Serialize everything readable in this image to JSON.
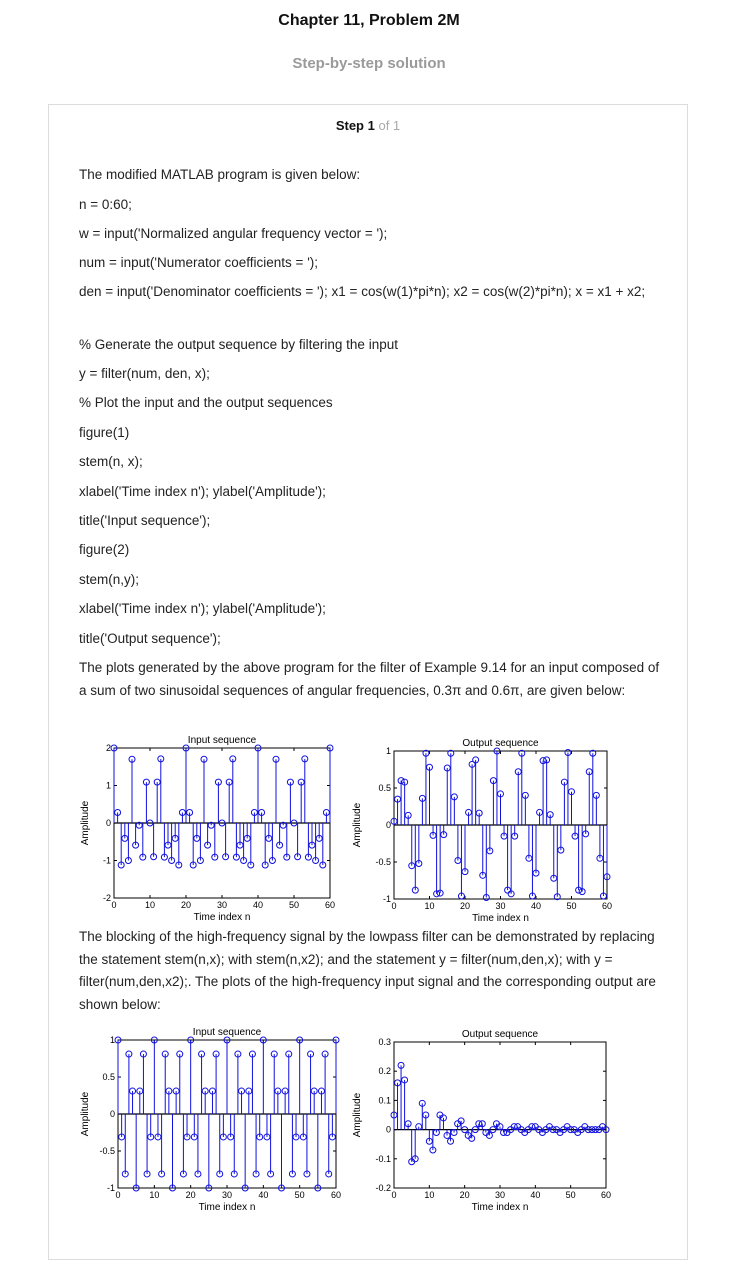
{
  "header": {
    "chapter_title": "Chapter 11, Problem 2M",
    "subtitle": "Step-by-step solution"
  },
  "step": {
    "label": "Step 1",
    "of": "of 1"
  },
  "body": {
    "intro": "The modified MATLAB program is given below:",
    "code": [
      "n = 0:60;",
      "w = input('Normalized angular frequency vector = ');",
      "num = input('Numerator coefficients = ');",
      "den = input('Denominator coefficients = '); x1 = cos(w(1)*pi*n); x2 = cos(w(2)*pi*n); x = x1 + x2;",
      "% Generate the output sequence by filtering the input",
      "y = filter(num, den, x);",
      "% Plot the input and the output sequences",
      "figure(1)",
      "stem(n, x);",
      "xlabel('Time index n'); ylabel('Amplitude');",
      "title('Input sequence');",
      "figure(2)",
      "stem(n,y);",
      "xlabel('Time index n'); ylabel('Amplitude');",
      "title('Output sequence');"
    ],
    "para1": "The plots generated by the above program for the filter of Example 9.14 for an input composed of a sum of two sinusoidal sequences of angular frequencies, 0.3π and 0.6π, are given below:",
    "para2": "The blocking of the high-frequency signal by the lowpass filter can be demonstrated by replacing the statement stem(n,x); with stem(n,x2); and the statement y = filter(num,den,x); with y = filter(num,den,x2);. The plots of the high-frequency input signal and the corresponding output are shown below:"
  },
  "chart_data": [
    {
      "type": "stem",
      "title": "Input sequence",
      "xlabel": "Time index n",
      "ylabel": "Amplitude",
      "xlim": [
        0,
        60
      ],
      "ylim": [
        -2,
        2
      ],
      "xticks": [
        0,
        10,
        20,
        30,
        40,
        50,
        60
      ],
      "yticks": [
        -2,
        -1,
        0,
        1,
        2
      ],
      "x": [
        0,
        1,
        2,
        3,
        4,
        5,
        6,
        7,
        8,
        9,
        10,
        11,
        12,
        13,
        14,
        15,
        16,
        17,
        18,
        19,
        20,
        21,
        22,
        23,
        24,
        25,
        26,
        27,
        28,
        29,
        30,
        31,
        32,
        33,
        34,
        35,
        36,
        37,
        38,
        39,
        40,
        41,
        42,
        43,
        44,
        45,
        46,
        47,
        48,
        49,
        50,
        51,
        52,
        53,
        54,
        55,
        56,
        57,
        58,
        59,
        60
      ],
      "y": [
        2,
        0.28,
        -1.12,
        -0.41,
        -1,
        1.7,
        -0.59,
        -0.06,
        -0.91,
        1.09,
        0,
        -0.9,
        1.09,
        1.71,
        -0.91,
        -0.59,
        -1,
        -0.41,
        -1.12,
        0.28,
        2,
        0.28,
        -1.12,
        -0.41,
        -1,
        1.7,
        -0.59,
        -0.06,
        -0.91,
        1.09,
        0,
        -0.9,
        1.09,
        1.71,
        -0.91,
        -0.59,
        -1,
        -0.41,
        -1.12,
        0.28,
        2,
        0.28,
        -1.12,
        -0.41,
        -1,
        1.7,
        -0.59,
        -0.06,
        -0.91,
        1.09,
        0,
        -0.9,
        1.09,
        1.71,
        -0.91,
        -0.59,
        -1,
        -0.41,
        -1.12,
        0.28,
        2
      ]
    },
    {
      "type": "stem",
      "title": "Output sequence",
      "xlabel": "Time index n",
      "ylabel": "Amplitude",
      "xlim": [
        0,
        60
      ],
      "ylim": [
        -1,
        1
      ],
      "xticks": [
        0,
        10,
        20,
        30,
        40,
        50,
        60
      ],
      "yticks": [
        -1,
        -0.5,
        0,
        0.5,
        1
      ],
      "x": [
        0,
        1,
        2,
        3,
        4,
        5,
        6,
        7,
        8,
        9,
        10,
        11,
        12,
        13,
        14,
        15,
        16,
        17,
        18,
        19,
        20,
        21,
        22,
        23,
        24,
        25,
        26,
        27,
        28,
        29,
        30,
        31,
        32,
        33,
        34,
        35,
        36,
        37,
        38,
        39,
        40,
        41,
        42,
        43,
        44,
        45,
        46,
        47,
        48,
        49,
        50,
        51,
        52,
        53,
        54,
        55,
        56,
        57,
        58,
        59,
        60
      ],
      "y": [
        0.05,
        0.35,
        0.6,
        0.58,
        0.13,
        -0.55,
        -0.88,
        -0.52,
        0.36,
        0.97,
        0.78,
        -0.14,
        -0.93,
        -0.92,
        -0.13,
        0.77,
        0.97,
        0.38,
        -0.48,
        -0.96,
        -0.63,
        0.17,
        0.82,
        0.88,
        0.16,
        -0.68,
        -0.98,
        -0.35,
        0.6,
        1,
        0.42,
        -0.15,
        -0.88,
        -0.93,
        -0.15,
        0.72,
        0.97,
        0.4,
        -0.45,
        -0.96,
        -0.65,
        0.17,
        0.87,
        0.88,
        0.14,
        -0.72,
        -0.97,
        -0.34,
        0.58,
        0.98,
        0.45,
        -0.15,
        -0.88,
        -0.9,
        -0.12,
        0.72,
        0.97,
        0.4,
        -0.45,
        -0.96,
        -0.7
      ]
    },
    {
      "type": "stem",
      "title": "Input sequence",
      "xlabel": "Time index n",
      "ylabel": "Amplitude",
      "xlim": [
        0,
        60
      ],
      "ylim": [
        -1,
        1
      ],
      "xticks": [
        0,
        10,
        20,
        30,
        40,
        50,
        60
      ],
      "yticks": [
        -1,
        -0.5,
        0,
        0.5,
        1
      ],
      "x": [
        0,
        1,
        2,
        3,
        4,
        5,
        6,
        7,
        8,
        9,
        10,
        11,
        12,
        13,
        14,
        15,
        16,
        17,
        18,
        19,
        20,
        21,
        22,
        23,
        24,
        25,
        26,
        27,
        28,
        29,
        30,
        31,
        32,
        33,
        34,
        35,
        36,
        37,
        38,
        39,
        40,
        41,
        42,
        43,
        44,
        45,
        46,
        47,
        48,
        49,
        50,
        51,
        52,
        53,
        54,
        55,
        56,
        57,
        58,
        59,
        60
      ],
      "y": [
        1,
        -0.31,
        -0.81,
        0.81,
        0.31,
        -1,
        0.31,
        0.81,
        -0.81,
        -0.31,
        1,
        -0.31,
        -0.81,
        0.81,
        0.31,
        -1,
        0.31,
        0.81,
        -0.81,
        -0.31,
        1,
        -0.31,
        -0.81,
        0.81,
        0.31,
        -1,
        0.31,
        0.81,
        -0.81,
        -0.31,
        1,
        -0.31,
        -0.81,
        0.81,
        0.31,
        -1,
        0.31,
        0.81,
        -0.81,
        -0.31,
        1,
        -0.31,
        -0.81,
        0.81,
        0.31,
        -1,
        0.31,
        0.81,
        -0.81,
        -0.31,
        1,
        -0.31,
        -0.81,
        0.81,
        0.31,
        -1,
        0.31,
        0.81,
        -0.81,
        -0.31,
        1
      ]
    },
    {
      "type": "stem",
      "title": "Output sequence",
      "xlabel": "Time index n",
      "ylabel": "Amplitude",
      "xlim": [
        0,
        60
      ],
      "ylim": [
        -0.2,
        0.3
      ],
      "xticks": [
        0,
        10,
        20,
        30,
        40,
        50,
        60
      ],
      "yticks": [
        -0.2,
        -0.1,
        0,
        0.1,
        0.2,
        0.3
      ],
      "x": [
        0,
        1,
        2,
        3,
        4,
        5,
        6,
        7,
        8,
        9,
        10,
        11,
        12,
        13,
        14,
        15,
        16,
        17,
        18,
        19,
        20,
        21,
        22,
        23,
        24,
        25,
        26,
        27,
        28,
        29,
        30,
        31,
        32,
        33,
        34,
        35,
        36,
        37,
        38,
        39,
        40,
        41,
        42,
        43,
        44,
        45,
        46,
        47,
        48,
        49,
        50,
        51,
        52,
        53,
        54,
        55,
        56,
        57,
        58,
        59,
        60
      ],
      "y": [
        0.05,
        0.16,
        0.22,
        0.17,
        0.02,
        -0.11,
        -0.1,
        0.01,
        0.09,
        0.05,
        -0.04,
        -0.07,
        -0.01,
        0.05,
        0.04,
        -0.02,
        -0.04,
        -0.01,
        0.02,
        0.03,
        0,
        -0.02,
        -0.03,
        0,
        0.02,
        0.02,
        -0.01,
        -0.02,
        0,
        0.02,
        0.01,
        -0.01,
        -0.01,
        0,
        0.01,
        0.01,
        0,
        -0.01,
        0,
        0.01,
        0.01,
        0,
        -0.01,
        0,
        0.01,
        0,
        0,
        -0.01,
        0,
        0.01,
        0,
        0,
        -0.01,
        0,
        0.01,
        0,
        0,
        0,
        0,
        0.01,
        0
      ]
    }
  ]
}
